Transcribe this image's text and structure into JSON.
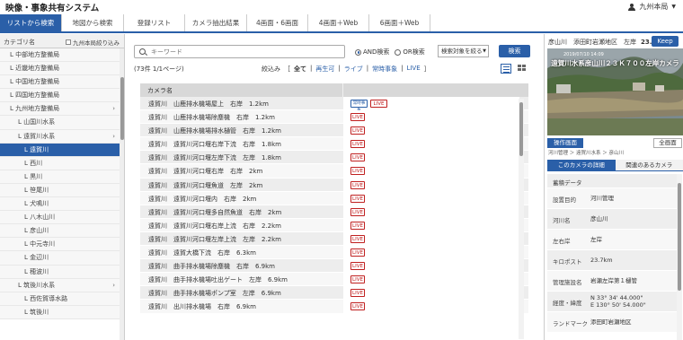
{
  "app": {
    "title": "映像・事象共有システム",
    "user": "九州本局"
  },
  "tabs": [
    {
      "label": "リストから検索",
      "active": true
    },
    {
      "label": "地図から検索",
      "active": false
    },
    {
      "label": "登録リスト",
      "active": false
    },
    {
      "label": "カメラ抽出結果",
      "active": false
    },
    {
      "label": "4画面・6画面",
      "active": false
    },
    {
      "label": "4画面＋Web",
      "active": false
    },
    {
      "label": "6画面＋Web",
      "active": false
    }
  ],
  "sidebar": {
    "header": "カテゴリ名",
    "checkbox_label": "九州本局絞り込み",
    "items": [
      {
        "label": "中部地方整備局",
        "level": 1,
        "selected": false,
        "chevron": false
      },
      {
        "label": "近畿地方整備局",
        "level": 1,
        "selected": false,
        "chevron": false
      },
      {
        "label": "中国地方整備局",
        "level": 1,
        "selected": false,
        "chevron": false
      },
      {
        "label": "四国地方整備局",
        "level": 1,
        "selected": false,
        "chevron": false
      },
      {
        "label": "九州地方整備局",
        "level": 1,
        "selected": false,
        "chevron": true
      },
      {
        "label": "山国川水系",
        "level": 2,
        "selected": false,
        "chevron": false
      },
      {
        "label": "遠賀川水系",
        "level": 2,
        "selected": false,
        "chevron": true
      },
      {
        "label": "遠賀川",
        "level": 3,
        "selected": true,
        "chevron": false
      },
      {
        "label": "西川",
        "level": 3,
        "selected": false,
        "chevron": false
      },
      {
        "label": "黒川",
        "level": 3,
        "selected": false,
        "chevron": false
      },
      {
        "label": "笹尾川",
        "level": 3,
        "selected": false,
        "chevron": false
      },
      {
        "label": "犬鳴川",
        "level": 3,
        "selected": false,
        "chevron": false
      },
      {
        "label": "八木山川",
        "level": 3,
        "selected": false,
        "chevron": false
      },
      {
        "label": "彦山川",
        "level": 3,
        "selected": false,
        "chevron": false
      },
      {
        "label": "中元寺川",
        "level": 3,
        "selected": false,
        "chevron": false
      },
      {
        "label": "金辺川",
        "level": 3,
        "selected": false,
        "chevron": false
      },
      {
        "label": "穂波川",
        "level": 3,
        "selected": false,
        "chevron": false
      },
      {
        "label": "筑後川水系",
        "level": 2,
        "selected": false,
        "chevron": true
      },
      {
        "label": "西佐賀導水路",
        "level": 3,
        "selected": false,
        "chevron": false
      },
      {
        "label": "筑後川",
        "level": 3,
        "selected": false,
        "chevron": false
      }
    ]
  },
  "search": {
    "placeholder": "キーワード",
    "and_label": "AND検索",
    "or_label": "OR検索",
    "target_select": "検索対象を絞る",
    "button": "検索"
  },
  "results": {
    "count_text": "(73件 1/1ページ)",
    "filter_label": "絞込み",
    "filters": [
      "全て",
      "再生可",
      "ライブ",
      "常時事象",
      "LIVE"
    ],
    "column_header": "カメラ名",
    "rows": [
      {
        "name": "遠賀川　山鹿排水機場屋上　右岸　1.2km",
        "badges": [
          "hd",
          "live"
        ]
      },
      {
        "name": "遠賀川　山鹿排水機場除塵機　右岸　1.2km",
        "badges": [
          "live"
        ]
      },
      {
        "name": "遠賀川　山鹿排水機場排水樋管　右岸　1.2km",
        "badges": [
          "live"
        ]
      },
      {
        "name": "遠賀川　遠賀川河口堰右岸下流　右岸　1.8km",
        "badges": [
          "live"
        ]
      },
      {
        "name": "遠賀川　遠賀川河口堰左岸下流　左岸　1.8km",
        "badges": [
          "live"
        ]
      },
      {
        "name": "遠賀川　遠賀川河口堰右岸　右岸　2km",
        "badges": [
          "live"
        ]
      },
      {
        "name": "遠賀川　遠賀川河口堰魚道　左岸　2km",
        "badges": [
          "live"
        ]
      },
      {
        "name": "遠賀川　遠賀川河口堰内　右岸　2km",
        "badges": [
          "live"
        ]
      },
      {
        "name": "遠賀川　遠賀川河口堰多自然魚道　右岸　2km",
        "badges": [
          "live"
        ]
      },
      {
        "name": "遠賀川　遠賀川河口堰右岸上流　右岸　2.2km",
        "badges": [
          "live"
        ]
      },
      {
        "name": "遠賀川　遠賀川河口堰左岸上流　左岸　2.2km",
        "badges": [
          "live"
        ]
      },
      {
        "name": "遠賀川　遠賀大橋下流　右岸　6.3km",
        "badges": [
          "live"
        ]
      },
      {
        "name": "遠賀川　曲手排水機場除塵機　右岸　6.9km",
        "badges": [
          "live"
        ]
      },
      {
        "name": "遠賀川　曲手排水機場吐出ゲート　左岸　6.9km",
        "badges": [
          "live"
        ]
      },
      {
        "name": "遠賀川　曲手排水機場ポンプ室　左岸　6.9km",
        "badges": [
          "live"
        ]
      },
      {
        "name": "遠賀川　出川排水機場　右岸　6.9km",
        "badges": [
          "live"
        ]
      }
    ],
    "badge_live": "LIVE",
    "badge_hd": "常時事象"
  },
  "camera": {
    "title": "彦山川　添田町岩瀬地区　左岸",
    "distance": "23.7km",
    "keep_button": "Keep",
    "video_caption": "遠賀川水系彦山川２３Ｋ７００左岸カメラ",
    "video_timestamp": "2019/07/10 14:09",
    "operate_button": "操作画面",
    "fullscreen_button": "全画面",
    "breadcrumb": "河川管理 ＞ 遠賀川水系 ＞ 彦山川",
    "tab_details": "このカメラの詳細",
    "tab_related": "関連のあるカメラ",
    "details": [
      {
        "key": "蓄積データ",
        "value": ""
      },
      {
        "key": "設置目的",
        "value": "河川管理"
      },
      {
        "key": "河川名",
        "value": "彦山川"
      },
      {
        "key": "左右岸",
        "value": "左岸"
      },
      {
        "key": "キロポスト",
        "value": "23.7km"
      },
      {
        "key": "管理施設名",
        "value": "岩瀬左岸第１樋管"
      },
      {
        "key": "経度・緯度",
        "value": "N 33° 34' 44.000\"\nE 130° 50' 54.000\""
      },
      {
        "key": "ランドマーク",
        "value": "添田町岩瀬地区"
      }
    ]
  },
  "colors": {
    "accent": "#2a5fa8",
    "live": "#c02020"
  }
}
